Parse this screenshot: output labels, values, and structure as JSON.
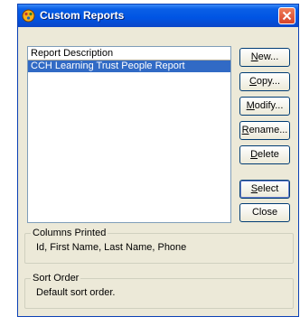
{
  "window": {
    "title": "Custom Reports",
    "close_glyph": "✕"
  },
  "list": {
    "header": "Report Description",
    "rows": [
      "CCH Learning Trust People Report"
    ]
  },
  "buttons": [
    {
      "label_pre": "",
      "mnemonic": "N",
      "label_post": "ew..."
    },
    {
      "label_pre": "",
      "mnemonic": "C",
      "label_post": "opy..."
    },
    {
      "label_pre": "",
      "mnemonic": "M",
      "label_post": "odify..."
    },
    {
      "label_pre": "",
      "mnemonic": "R",
      "label_post": "ename..."
    },
    {
      "label_pre": "",
      "mnemonic": "D",
      "label_post": "elete"
    },
    {
      "label_pre": "",
      "mnemonic": "S",
      "label_post": "elect"
    },
    {
      "label_pre": "",
      "mnemonic": "",
      "label_post": "Close"
    }
  ],
  "columns_printed": {
    "label": "Columns Printed",
    "value": "Id,  First Name, Last Name, Phone"
  },
  "sort_order": {
    "label": "Sort Order",
    "value": "Default sort order."
  },
  "colors": {
    "title_bar": "#0054e3",
    "selection": "#316ac5",
    "dialog_bg": "#ece9d8",
    "close_button": "#d6432a"
  }
}
